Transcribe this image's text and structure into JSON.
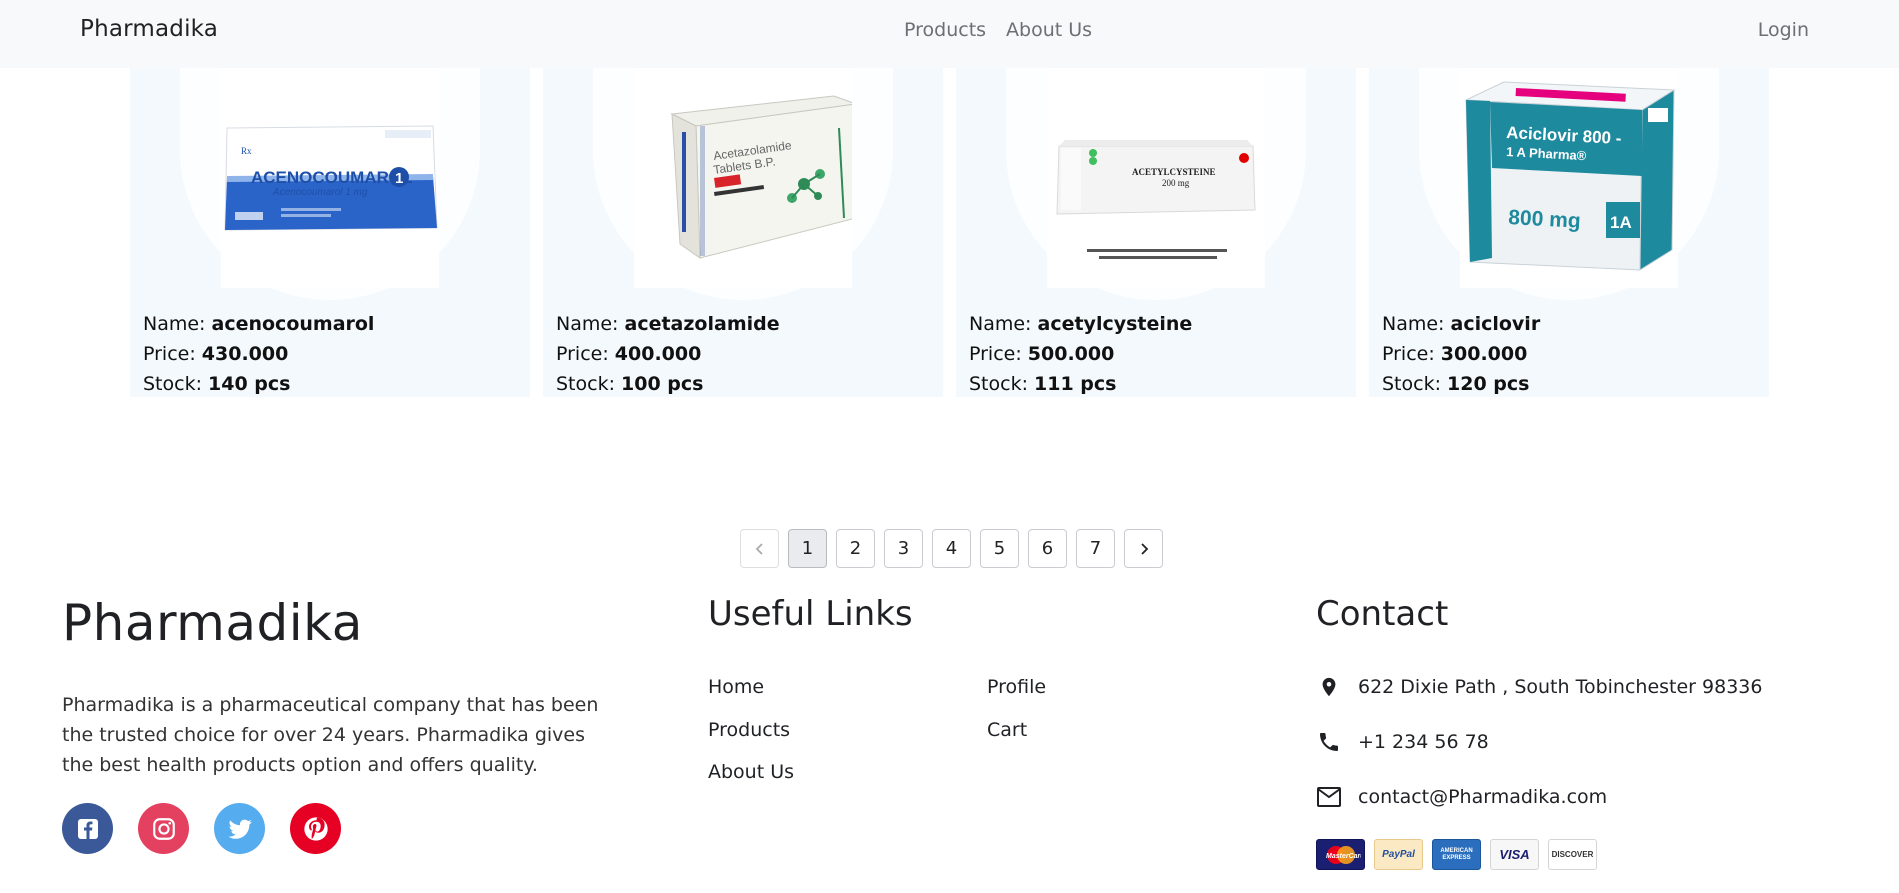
{
  "navbar": {
    "brand": "Pharmadika",
    "links": [
      "Products",
      "About Us"
    ],
    "login": "Login"
  },
  "products": [
    {
      "name_label": "Name: ",
      "name": "acenocoumarol",
      "price_label": "Price: ",
      "price": "430.000",
      "stock_label": "Stock: ",
      "stock": "140 pcs",
      "box_brand": "ACENOCOUMAROL",
      "box_sub": "Acenocoumarol 1 mg"
    },
    {
      "name_label": "Name: ",
      "name": "acetazolamide",
      "price_label": "Price: ",
      "price": "400.000",
      "stock_label": "Stock: ",
      "stock": "100 pcs",
      "box_brand": "Acetazolamide",
      "box_sub": "Tablets B.P."
    },
    {
      "name_label": "Name: ",
      "name": "acetylcysteine",
      "price_label": "Price: ",
      "price": "500.000",
      "stock_label": "Stock: ",
      "stock": "111 pcs",
      "box_brand": "ACETYLCYSTEINE",
      "box_sub": "200 mg"
    },
    {
      "name_label": "Name: ",
      "name": "aciclovir",
      "price_label": "Price: ",
      "price": "300.000",
      "stock_label": "Stock: ",
      "stock": "120 pcs",
      "box_brand": "Aciclovir 800 -",
      "box_sub": "800 mg"
    }
  ],
  "pagination": {
    "prev_icon": "chevron-left-icon",
    "pages": [
      "1",
      "2",
      "3",
      "4",
      "5",
      "6",
      "7"
    ],
    "active": "1",
    "next_icon": "chevron-right-icon"
  },
  "footer": {
    "brand": "Pharmadika",
    "about": "Pharmadika is a pharmaceutical company that has been the trusted choice for over 24 years. Pharmadika gives the best health products option and offers quality.",
    "socials": [
      "facebook-icon",
      "instagram-icon",
      "twitter-icon",
      "pinterest-icon"
    ],
    "links_title": "Useful Links",
    "links": [
      "Home",
      "Products",
      "About Us",
      "Profile",
      "Cart"
    ],
    "contact_title": "Contact",
    "address": "622 Dixie Path , South Tobinchester 98336",
    "phone": "+1 234 56 78",
    "email": "contact@Pharmadika.com",
    "payments": [
      "MasterCard",
      "PayPal",
      "AMERICAN EXPRESS",
      "VISA",
      "DISCOVER"
    ]
  },
  "colors": {
    "navbar_bg": "#f8f9fa",
    "card_bg": "#f3f9fc",
    "facebook": "#3b5998",
    "instagram": "#e4405f",
    "twitter": "#55acee",
    "pinterest": "#e60023"
  }
}
